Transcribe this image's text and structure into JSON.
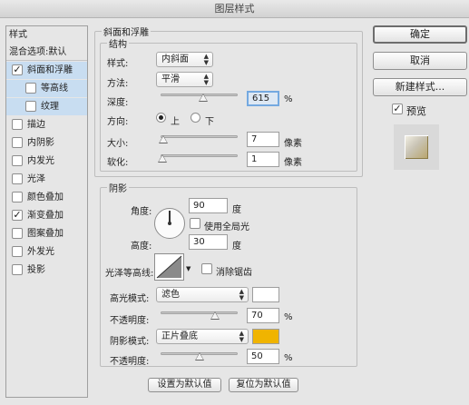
{
  "window": {
    "title": "图层样式"
  },
  "left_panel": {
    "header": "样式",
    "blend_options": "混合选项:默认",
    "items": [
      {
        "label": "斜面和浮雕",
        "checked": true,
        "mark": "✓"
      },
      {
        "label": "等高线",
        "checked": false,
        "mark": ""
      },
      {
        "label": "纹理",
        "checked": false,
        "mark": ""
      },
      {
        "label": "描边",
        "checked": false,
        "mark": ""
      },
      {
        "label": "内阴影",
        "checked": false,
        "mark": ""
      },
      {
        "label": "内发光",
        "checked": false,
        "mark": ""
      },
      {
        "label": "光泽",
        "checked": false,
        "mark": ""
      },
      {
        "label": "颜色叠加",
        "checked": false,
        "mark": ""
      },
      {
        "label": "渐变叠加",
        "checked": true,
        "mark": "✓"
      },
      {
        "label": "图案叠加",
        "checked": false,
        "mark": ""
      },
      {
        "label": "外发光",
        "checked": false,
        "mark": ""
      },
      {
        "label": "投影",
        "checked": false,
        "mark": ""
      }
    ]
  },
  "bevel": {
    "group_title": "斜面和浮雕",
    "structure_title": "结构",
    "style_label": "样式:",
    "style_value": "内斜面",
    "technique_label": "方法:",
    "technique_value": "平滑",
    "depth_label": "深度:",
    "depth_value": "615",
    "depth_unit": "%",
    "depth_slider": 0.55,
    "direction_label": "方向:",
    "direction_up": "上",
    "direction_down": "下",
    "direction_selected": "上",
    "size_label": "大小:",
    "size_value": "7",
    "size_unit": "像素",
    "size_slider": 0.03,
    "soften_label": "软化:",
    "soften_value": "1",
    "soften_unit": "像素",
    "soften_slider": 0.02
  },
  "shading": {
    "group_title": "阴影",
    "angle_label": "角度:",
    "angle_value": "90",
    "angle_unit": "度",
    "global_light_label": "使用全局光",
    "global_light_checked": false,
    "altitude_label": "高度:",
    "altitude_value": "30",
    "altitude_unit": "度",
    "gloss_contour_label": "光泽等高线:",
    "anti_aliased_label": "消除锯齿",
    "anti_aliased_checked": false,
    "highlight_mode_label": "高光模式:",
    "highlight_mode_value": "滤色",
    "highlight_color": "#ffffff",
    "highlight_opacity_label": "不透明度:",
    "highlight_opacity_value": "70",
    "highlight_opacity_unit": "%",
    "highlight_opacity_slider": 0.7,
    "shadow_mode_label": "阴影模式:",
    "shadow_mode_value": "正片叠底",
    "shadow_color": "#f0b400",
    "shadow_opacity_label": "不透明度:",
    "shadow_opacity_value": "50",
    "shadow_opacity_unit": "%",
    "shadow_opacity_slider": 0.5
  },
  "footer": {
    "make_default": "设置为默认值",
    "reset_default": "复位为默认值"
  },
  "right_panel": {
    "ok": "确定",
    "cancel": "取消",
    "new_style": "新建样式...",
    "preview_label": "预览",
    "preview_checked": true,
    "preview_mark": "✓"
  },
  "icons": {
    "checkmark": "checkmark-icon",
    "dropdown": "chevron-updown-icon",
    "angle_dial": "angle-dial-icon",
    "contour": "contour-curve-icon"
  }
}
